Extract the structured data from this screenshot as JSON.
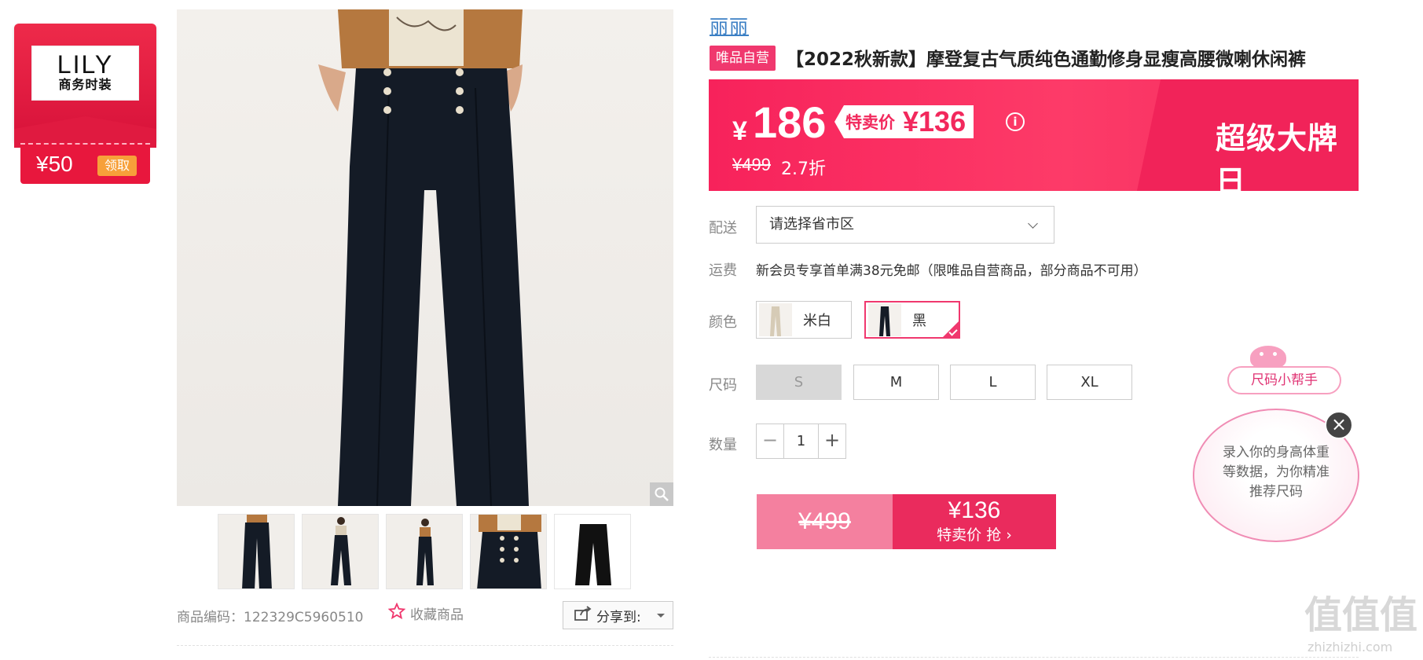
{
  "brand_badge": {
    "logo_line1": "LILY",
    "logo_line2": "商务时装",
    "coupon_amount": "¥50",
    "coupon_claim": "领取"
  },
  "gallery": {
    "thumbnails": [
      "thumb-1",
      "thumb-2",
      "thumb-3",
      "thumb-4",
      "thumb-5"
    ]
  },
  "meta": {
    "product_code": "商品编码：122329C5960510",
    "favorite_label": "收藏商品",
    "share_label": "分享到:"
  },
  "product": {
    "brand": "丽丽",
    "self_badge": "唯品自营",
    "title": "【2022秋新款】摩登复古气质纯色通勤修身显瘦高腰微喇休闲裤"
  },
  "price": {
    "currency": "¥",
    "main": "186",
    "special_label": "特卖价",
    "special_value": "¥136",
    "original": "¥499",
    "discount": "2.7折",
    "event": "超级大牌日"
  },
  "delivery": {
    "label": "配送",
    "placeholder": "请选择省市区"
  },
  "shipping": {
    "label": "运费",
    "text": "新会员专享首单满38元免邮（限唯品自营商品，部分商品不可用）"
  },
  "color": {
    "label": "颜色",
    "options": [
      {
        "name": "米白",
        "selected": false
      },
      {
        "name": "黑",
        "selected": true
      }
    ]
  },
  "size": {
    "label": "尺码",
    "options": [
      "S",
      "M",
      "L",
      "XL"
    ]
  },
  "quantity": {
    "label": "数量",
    "value": "1",
    "minus": "−",
    "plus": "+"
  },
  "buy_button": {
    "original": "¥499",
    "price": "¥136",
    "sub": "特卖价 抢 ›"
  },
  "size_helper": {
    "tag": "尺码小帮手",
    "text": "录入你的身高体重等数据，为你精准推荐尺码",
    "close": "×"
  },
  "watermark": {
    "text": "值值值",
    "url": "zhizhizhi.com"
  },
  "colors": {
    "accent": "#f0386e",
    "banner": "#f7225b",
    "link": "#3b7fc4"
  }
}
